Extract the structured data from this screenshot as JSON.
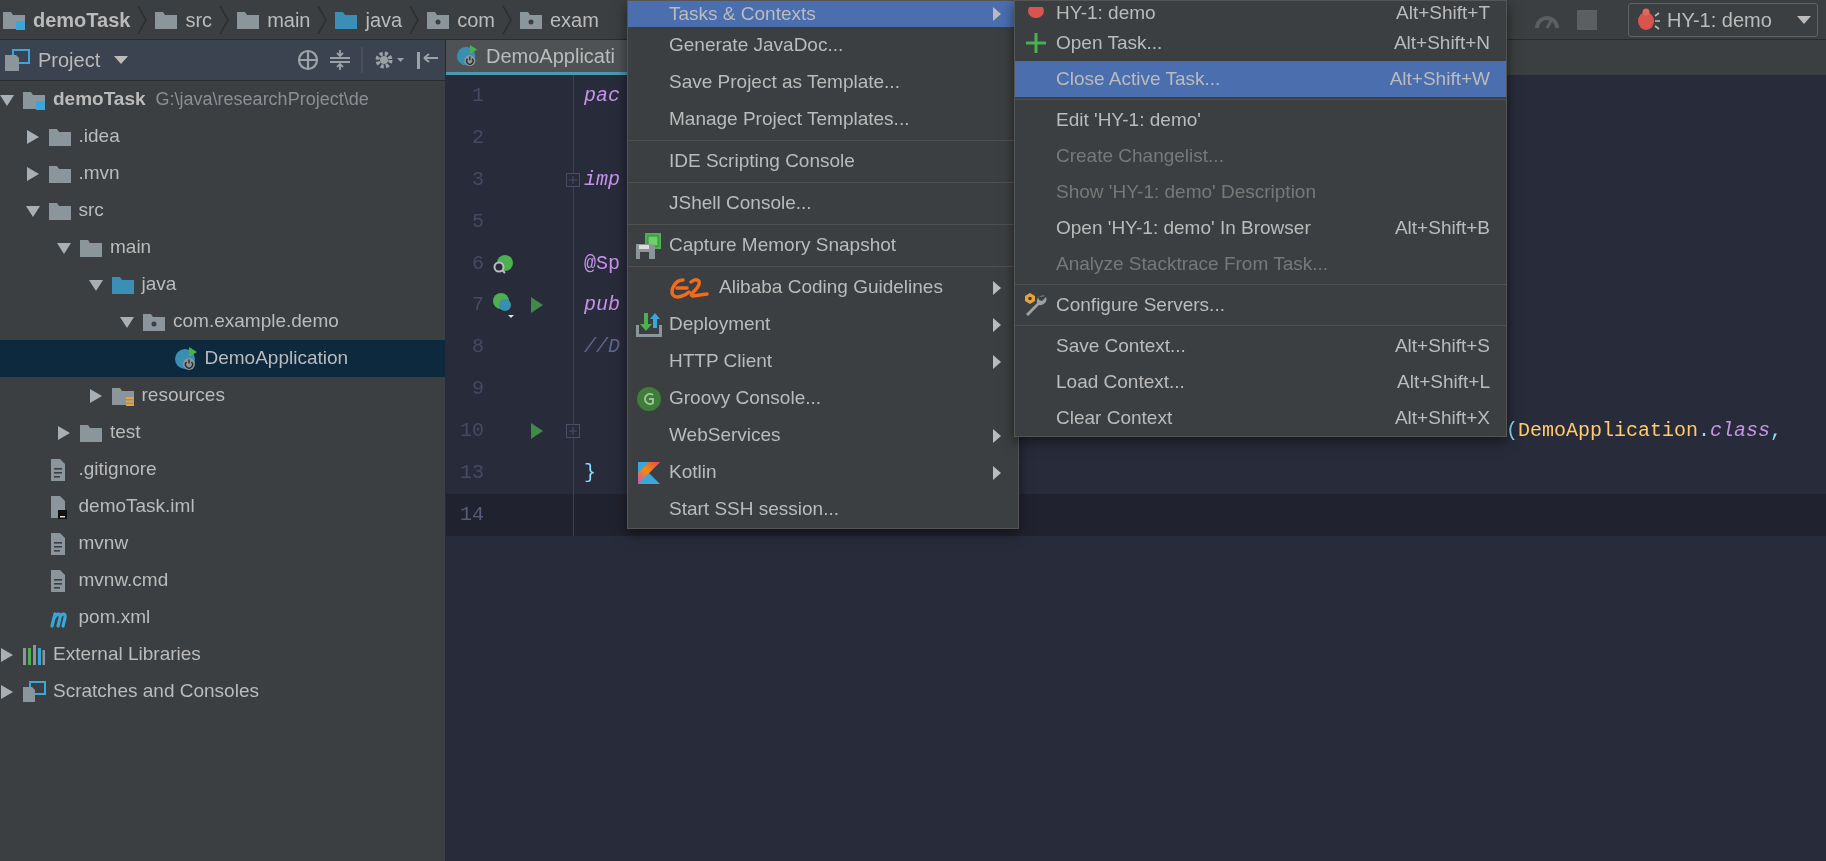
{
  "breadcrumbs": [
    {
      "label": "demoTask",
      "kind": "module"
    },
    {
      "label": "src",
      "kind": "folder"
    },
    {
      "label": "main",
      "kind": "folder"
    },
    {
      "label": "java",
      "kind": "source-folder"
    },
    {
      "label": "com",
      "kind": "package"
    },
    {
      "label": "exam",
      "kind": "package"
    }
  ],
  "task_selector": {
    "label": "HY-1: demo"
  },
  "project_panel": {
    "title": "Project"
  },
  "tree": [
    {
      "label": "demoTask",
      "kind": "module",
      "path": "G:\\java\\researchProject\\de",
      "expanded": true,
      "selected": false,
      "children": [
        {
          "label": ".idea",
          "kind": "folder",
          "expanded": false,
          "selected": false
        },
        {
          "label": ".mvn",
          "kind": "folder",
          "expanded": false,
          "selected": false
        },
        {
          "label": "src",
          "kind": "folder",
          "expanded": true,
          "selected": false,
          "children": [
            {
              "label": "main",
              "kind": "folder",
              "expanded": true,
              "selected": false,
              "children": [
                {
                  "label": "java",
                  "kind": "source-folder",
                  "expanded": true,
                  "selected": false,
                  "children": [
                    {
                      "label": "com.example.demo",
                      "kind": "package",
                      "expanded": true,
                      "selected": false,
                      "children": [
                        {
                          "label": "DemoApplication",
                          "kind": "spring-class",
                          "selected": true
                        }
                      ]
                    }
                  ]
                },
                {
                  "label": "resources",
                  "kind": "resources-folder",
                  "expanded": false,
                  "selected": false
                }
              ]
            },
            {
              "label": "test",
              "kind": "folder",
              "expanded": false,
              "selected": false
            }
          ]
        },
        {
          "label": ".gitignore",
          "kind": "file",
          "selected": false
        },
        {
          "label": "demoTask.iml",
          "kind": "iml",
          "selected": false
        },
        {
          "label": "mvnw",
          "kind": "file",
          "selected": false
        },
        {
          "label": "mvnw.cmd",
          "kind": "file",
          "selected": false
        },
        {
          "label": "pom.xml",
          "kind": "maven",
          "selected": false
        }
      ]
    },
    {
      "label": "External Libraries",
      "kind": "libraries",
      "expanded": false,
      "selected": false
    },
    {
      "label": "Scratches and Consoles",
      "kind": "scratches",
      "expanded": false,
      "selected": false
    }
  ],
  "editor": {
    "tab": {
      "label": "DemoApplicati",
      "selected": true
    },
    "lines": [
      {
        "number": "1",
        "current": false,
        "code": [
          {
            "text": "pac",
            "kind": "keyword"
          }
        ]
      },
      {
        "number": "2",
        "current": false
      },
      {
        "number": "3",
        "current": false,
        "code": [
          {
            "text": "imp",
            "kind": "keyword"
          }
        ]
      },
      {
        "number": "5",
        "current": false
      },
      {
        "number": "6",
        "current": false,
        "code": [
          {
            "text": "@Sp",
            "kind": "annotation"
          }
        ]
      },
      {
        "number": "7",
        "current": false,
        "code": [
          {
            "text": "pub",
            "kind": "keyword"
          }
        ]
      },
      {
        "number": "8",
        "current": false,
        "code": [
          {
            "text": "//D",
            "kind": "comment"
          }
        ]
      },
      {
        "number": "9",
        "current": false
      },
      {
        "number": "10",
        "current": false,
        "code": [
          {
            "text": "(",
            "kind": "punct"
          },
          {
            "text": "DemoApplication",
            "kind": "type"
          },
          {
            "text": ".",
            "kind": "punct"
          },
          {
            "text": "class",
            "kind": "keyword"
          },
          {
            "text": ",",
            "kind": "punct"
          }
        ]
      },
      {
        "number": "13",
        "current": false,
        "code": [
          {
            "text": "}",
            "kind": "punct"
          }
        ]
      },
      {
        "number": "14",
        "current": true
      }
    ]
  },
  "tools_menu": {
    "items": [
      {
        "kind": "item",
        "label": "Tasks & Contexts",
        "has_submenu": true,
        "selected": true
      },
      {
        "kind": "item",
        "label": "Generate JavaDoc...",
        "has_submenu": false,
        "selected": false
      },
      {
        "kind": "item",
        "label": "Save Project as Template...",
        "has_submenu": false,
        "selected": false
      },
      {
        "kind": "item",
        "label": "Manage Project Templates...",
        "has_submenu": false,
        "selected": false
      },
      {
        "kind": "separator"
      },
      {
        "kind": "item",
        "label": "IDE Scripting Console",
        "has_submenu": false,
        "selected": false
      },
      {
        "kind": "separator"
      },
      {
        "kind": "item",
        "label": "JShell Console...",
        "has_submenu": false,
        "selected": false
      },
      {
        "kind": "separator"
      },
      {
        "kind": "item",
        "label": "Capture Memory Snapshot",
        "has_submenu": false,
        "selected": false
      },
      {
        "kind": "separator"
      },
      {
        "kind": "item",
        "label": "Alibaba Coding Guidelines",
        "has_submenu": true,
        "selected": false
      },
      {
        "kind": "item",
        "label": "Deployment",
        "has_submenu": true,
        "selected": false
      },
      {
        "kind": "item",
        "label": "HTTP Client",
        "has_submenu": true,
        "selected": false
      },
      {
        "kind": "item",
        "label": "Groovy Console...",
        "has_submenu": false,
        "selected": false
      },
      {
        "kind": "item",
        "label": "WebServices",
        "has_submenu": true,
        "selected": false
      },
      {
        "kind": "item",
        "label": "Kotlin",
        "has_submenu": true,
        "selected": false
      },
      {
        "kind": "item",
        "label": "Start SSH session...",
        "has_submenu": false,
        "selected": false
      }
    ]
  },
  "tasks_submenu": {
    "items": [
      {
        "kind": "item",
        "label": "HY-1: demo",
        "shortcut": "Alt+Shift+T",
        "selected": false,
        "disabled": false
      },
      {
        "kind": "item",
        "label": "Open Task...",
        "shortcut": "Alt+Shift+N",
        "selected": false,
        "disabled": false
      },
      {
        "kind": "item",
        "label": "Close Active Task...",
        "shortcut": "Alt+Shift+W",
        "selected": true,
        "disabled": false
      },
      {
        "kind": "separator"
      },
      {
        "kind": "item",
        "label": "Edit 'HY-1: demo'",
        "selected": false,
        "disabled": false
      },
      {
        "kind": "item",
        "label": "Create Changelist...",
        "selected": false,
        "disabled": true
      },
      {
        "kind": "item",
        "label": "Show 'HY-1: demo' Description",
        "selected": false,
        "disabled": true
      },
      {
        "kind": "item",
        "label": "Open 'HY-1: demo' In Browser",
        "shortcut": "Alt+Shift+B",
        "selected": false,
        "disabled": false
      },
      {
        "kind": "item",
        "label": "Analyze Stacktrace From Task...",
        "selected": false,
        "disabled": true
      },
      {
        "kind": "separator"
      },
      {
        "kind": "item",
        "label": "Configure Servers...",
        "selected": false,
        "disabled": false
      },
      {
        "kind": "separator"
      },
      {
        "kind": "item",
        "label": "Save Context...",
        "shortcut": "Alt+Shift+S",
        "selected": false,
        "disabled": false
      },
      {
        "kind": "item",
        "label": "Load Context...",
        "shortcut": "Alt+Shift+L",
        "selected": false,
        "disabled": false
      },
      {
        "kind": "item",
        "label": "Clear Context",
        "shortcut": "Alt+Shift+X",
        "selected": false,
        "disabled": false
      }
    ]
  }
}
